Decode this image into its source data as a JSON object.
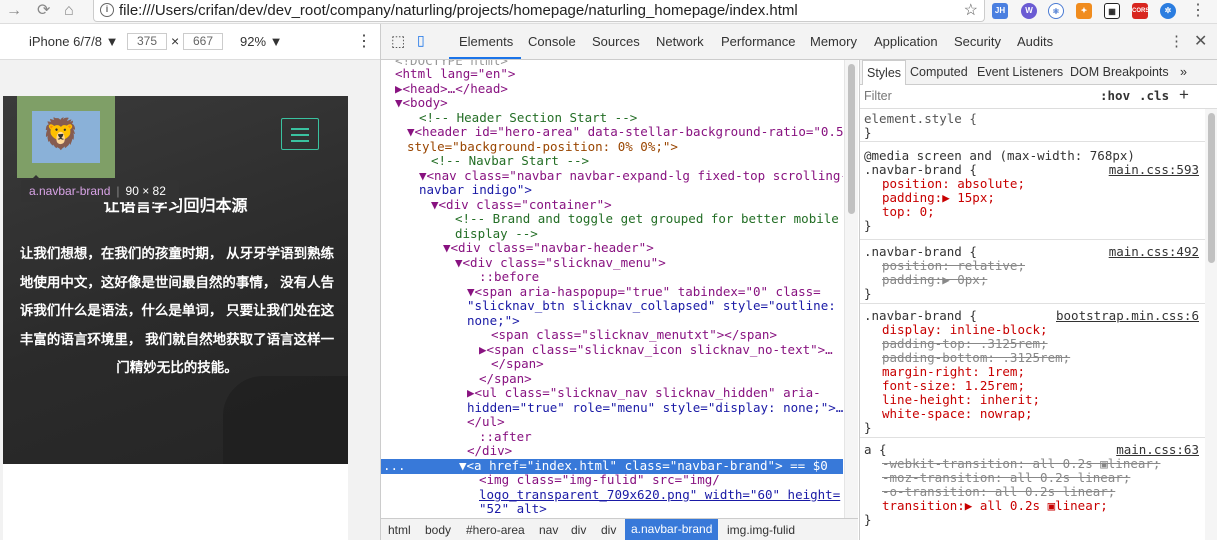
{
  "browser": {
    "url": "file:///Users/crifan/dev/dev_root/company/naturling/projects/homepage/naturling_homepage/index.html",
    "ext": [
      "JH",
      "CORS"
    ]
  },
  "device": {
    "model": "iPhone 6/7/8 ▼",
    "width": "375",
    "times": "×",
    "height": "667",
    "zoom": "92% ▼"
  },
  "page": {
    "tooltip_tag": "a.navbar-brand",
    "tooltip_size": "90 × 82",
    "title": "让语言学习回归本源",
    "text": "让我们想想，在我们的孩童时期， 从牙牙学语到熟练地使用中文，这好像是世间最自然的事情， 没有人告诉我们什么是语法，什么是单词， 只要让我们处在这丰富的语言环境里， 我们就自然地获取了语言这样一门精妙无比的技能。"
  },
  "devtools": {
    "tabs": [
      "Elements",
      "Console",
      "Sources",
      "Network",
      "Performance",
      "Memory",
      "Application",
      "Security",
      "Audits"
    ]
  },
  "dom": [
    "<!DOCTYPE html>",
    "<html lang=\"en\">",
    "▶<head>…</head>",
    "▼<body>",
    "<!-- Header Section Start -->",
    "▼<header id=\"hero-area\" data-stellar-background-ratio=\"0.5\"",
    "style=\"background-position: 0% 0%;\">",
    "<!-- Navbar Start -->",
    "▼<nav class=\"navbar navbar-expand-lg fixed-top scrolling-",
    "navbar indigo\">",
    "▼<div class=\"container\">",
    "<!-- Brand and toggle get grouped for better mobile",
    "display -->",
    "▼<div class=\"navbar-header\">",
    "▼<div class=\"slicknav_menu\">",
    "::before",
    "▼<span aria-haspopup=\"true\" tabindex=\"0\" class=",
    "\"slicknav_btn slicknav_collapsed\" style=\"outline:",
    "none;\">",
    "<span class=\"slicknav_menutxt\"></span>",
    "▶<span class=\"slicknav_icon slicknav_no-text\">…",
    "</span>",
    "</span>",
    "▶<ul class=\"slicknav_nav slicknav_hidden\" aria-",
    "hidden=\"true\" role=\"menu\" style=\"display: none;\">…",
    "</ul>",
    "::after",
    "</div>",
    "▼<a href=\"index.html\" class=\"navbar-brand\"> == $0",
    "<img class=\"img-fulid\" src=\"img/",
    "logo_transparent_709x620.png\" width=\"60\" height=",
    "\"52\" alt>"
  ],
  "crumbs": [
    "html",
    "body",
    "#hero-area",
    "nav",
    "div",
    "div",
    "a.navbar-brand",
    "img.img-fulid"
  ],
  "styles": {
    "tabs": [
      "Styles",
      "Computed",
      "Event Listeners",
      "DOM Breakpoints",
      "»"
    ],
    "filter": "Filter",
    "hov": ":hov",
    ".cls": ".cls",
    "plus": "+",
    "element_style": "element.style {",
    "media": "@media screen and (max-width: 768px)",
    "r1_sel": ".navbar-brand {",
    "r1_src": "main.css:593",
    "r1": [
      "position: absolute;",
      "padding:▶ 15px;",
      "top: 0;"
    ],
    "r2_sel": ".navbar-brand {",
    "r2_src": "main.css:492",
    "r2": [
      "position: relative;",
      "padding:▶ 0px;"
    ],
    "r3_sel": ".navbar-brand {",
    "r3_src": "bootstrap.min.css:6",
    "r3": [
      "display: inline-block;",
      "padding-top: .3125rem;",
      "padding-bottom: .3125rem;",
      "margin-right: 1rem;",
      "font-size: 1.25rem;",
      "line-height: inherit;",
      "white-space: nowrap;"
    ],
    "r4_sel": "a {",
    "r4_src": "main.css:63",
    "r4": [
      "-webkit-transition: all 0.2s ▣linear;",
      "-moz-transition: all 0.2s linear;",
      "-o-transition: all 0.2s linear;",
      "transition:▶ all 0.2s ▣linear;"
    ],
    "close": "}"
  }
}
